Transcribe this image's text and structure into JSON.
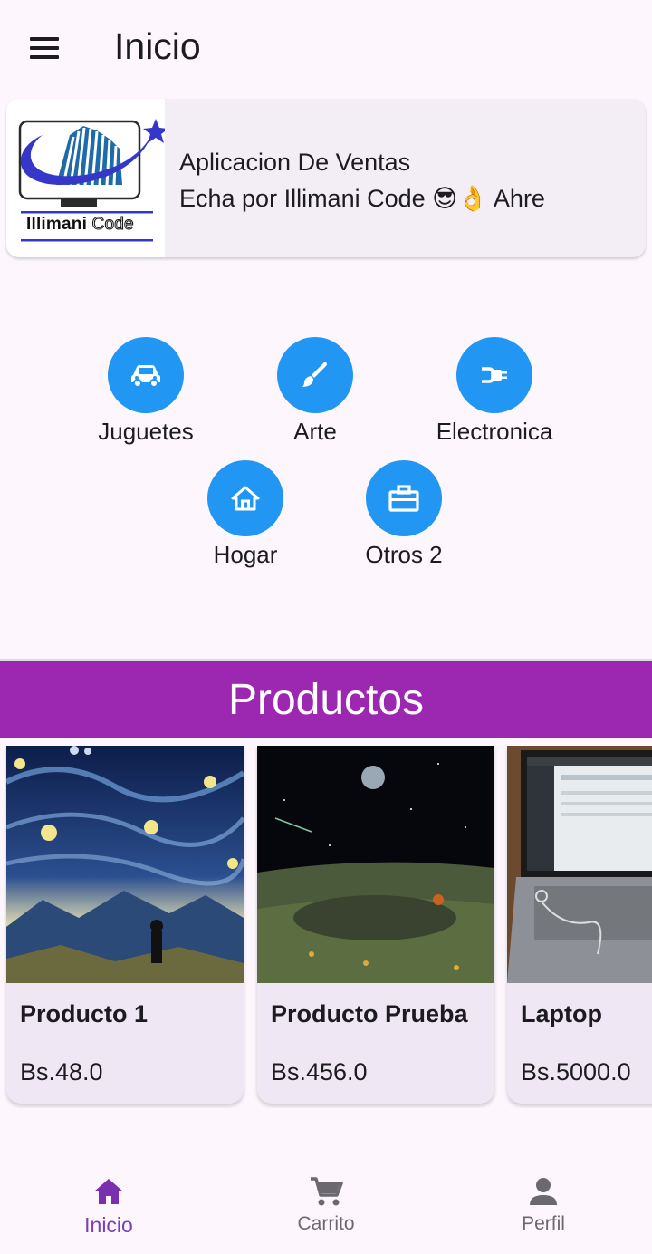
{
  "appbar": {
    "title": "Inicio",
    "menu_icon": "menu-icon"
  },
  "hero": {
    "logo_text_bold": "Illimani",
    "logo_text_light": "Code",
    "line1": "Aplicacion De Ventas",
    "line2": "Echa por Illimani Code  😎👌 Ahre"
  },
  "categories": [
    {
      "label": "Juguetes",
      "icon": "toy-car-icon"
    },
    {
      "label": "Arte",
      "icon": "brush-icon"
    },
    {
      "label": "Electronica",
      "icon": "power-plug-icon"
    },
    {
      "label": "Hogar",
      "icon": "home-icon"
    },
    {
      "label": "Otros 2",
      "icon": "briefcase-icon"
    }
  ],
  "section": {
    "title": "Productos"
  },
  "products": [
    {
      "name": "Producto 1",
      "price": "Bs.48.0"
    },
    {
      "name": "Producto Prueba",
      "price": "Bs.456.0"
    },
    {
      "name": "Laptop",
      "price": "Bs.5000.0"
    }
  ],
  "bottom_nav": [
    {
      "label": "Inicio",
      "icon": "home-icon",
      "active": true
    },
    {
      "label": "Carrito",
      "icon": "cart-icon",
      "active": false
    },
    {
      "label": "Perfil",
      "icon": "person-icon",
      "active": false
    }
  ],
  "colors": {
    "accent_purple": "#9c27b0",
    "category_blue": "#2196f3",
    "nav_active": "#7a3fb5",
    "background": "#fdf7fd"
  }
}
